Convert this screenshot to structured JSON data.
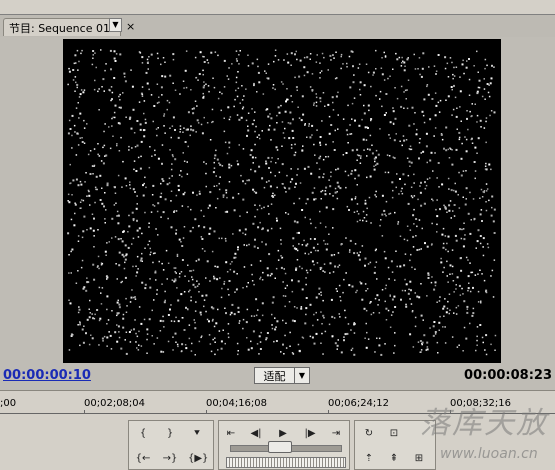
{
  "panel": {
    "tab_label": "节目: Sequence 01",
    "tab_menu_arrow": "▼",
    "tab_close": "×"
  },
  "monitor": {
    "current_timecode": "00:00:00:10",
    "duration_timecode": "00:00:08:23",
    "fit_label": "适配",
    "fit_arrow": "▼"
  },
  "ruler": {
    "labels": [
      ";00",
      "00;02;08;04",
      "00;04;16;08",
      "00;06;24;12",
      "00;08;32;16"
    ]
  },
  "controls": {
    "set_in": "{",
    "set_out": "}",
    "add_marker": "⯆",
    "goto_in": "{←",
    "goto_out": "→}",
    "play_in_to_out": "{▶}",
    "step_to_edit_back": "⇤",
    "step_back": "◀|",
    "play": "▶",
    "step_forward": "|▶",
    "step_to_edit_forward": "⇥",
    "loop": "↻",
    "safe_margins": "⊡",
    "lift": "⇡",
    "extract": "⇞",
    "export_frame": "⊞"
  },
  "watermark": {
    "text": "落库天放",
    "url": "www.luoan.cn"
  }
}
